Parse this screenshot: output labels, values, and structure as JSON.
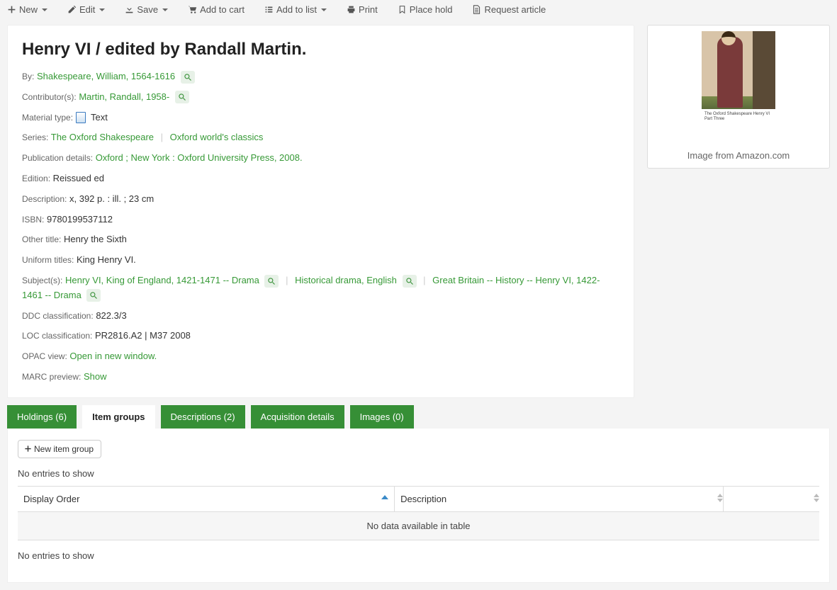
{
  "toolbar": {
    "new": "New",
    "edit": "Edit",
    "save": "Save",
    "add_to_cart": "Add to cart",
    "add_to_list": "Add to list",
    "print": "Print",
    "place_hold": "Place hold",
    "request_article": "Request article"
  },
  "record": {
    "title": "Henry VI / edited by Randall Martin.",
    "by_label": "By:",
    "by_author": "Shakespeare, William, 1564-1616",
    "contributor_label": "Contributor(s):",
    "contributor": "Martin, Randall, 1958-",
    "material_type_label": "Material type:",
    "material_type": "Text",
    "series_label": "Series:",
    "series1": "The Oxford Shakespeare",
    "series2": "Oxford world's classics",
    "publication_label": "Publication details:",
    "publication": "Oxford ; New York : Oxford University Press, 2008.",
    "edition_label": "Edition:",
    "edition": "Reissued ed",
    "description_label": "Description:",
    "description": "x, 392 p. : ill. ; 23 cm",
    "isbn_label": "ISBN:",
    "isbn": "9780199537112",
    "other_title_label": "Other title:",
    "other_title": "Henry the Sixth",
    "uniform_titles_label": "Uniform titles:",
    "uniform_titles": "King Henry VI.",
    "subjects_label": "Subject(s):",
    "subject1": "Henry VI, King of England, 1421-1471 -- Drama",
    "subject2": "Historical drama, English",
    "subject3": "Great Britain -- History -- Henry VI, 1422-1461 -- Drama",
    "ddc_label": "DDC classification:",
    "ddc": "822.3/3",
    "loc_label": "LOC classification:",
    "loc": "PR2816.A2 | M37 2008",
    "opac_label": "OPAC view:",
    "opac_link": "Open in new window.",
    "marc_label": "MARC preview:",
    "marc_link": "Show"
  },
  "cover": {
    "band_text": "The Oxford Shakespeare\nHenry VI\nPart Three",
    "caption": "Image from Amazon.com"
  },
  "tabs": {
    "holdings": "Holdings (6)",
    "item_groups": "Item groups",
    "descriptions": "Descriptions (2)",
    "acquisition": "Acquisition details",
    "images": "Images (0)"
  },
  "item_groups": {
    "new_button": "New item group",
    "entries_top": "No entries to show",
    "col_display_order": "Display Order",
    "col_description": "Description",
    "no_data": "No data available in table",
    "entries_bottom": "No entries to show"
  }
}
